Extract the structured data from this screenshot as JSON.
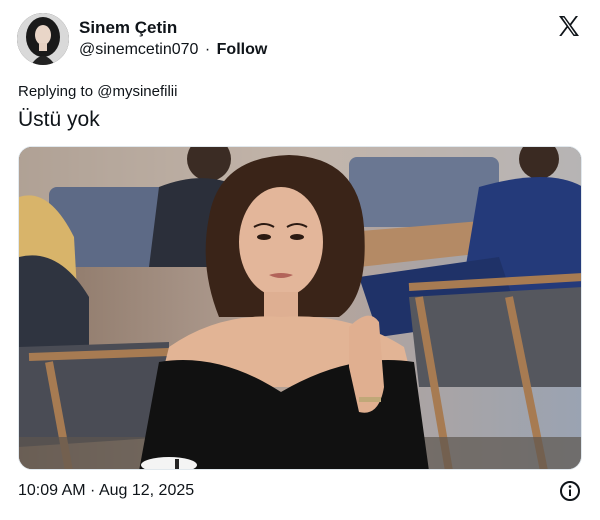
{
  "author": {
    "name": "Sinem Çetin",
    "handle": "@sinemcetin070",
    "separator": "·",
    "follow_label": "Follow"
  },
  "reply": {
    "prefix": "Replying to ",
    "mention": "@mysinefilii"
  },
  "tweet": {
    "text": "Üstü yok",
    "timestamp": "10:09 AM · Aug 12, 2025"
  },
  "icons": {
    "brand": "x-logo-icon",
    "info": "info-icon"
  },
  "colors": {
    "text": "#0f1419",
    "border": "#e1e8ed"
  }
}
